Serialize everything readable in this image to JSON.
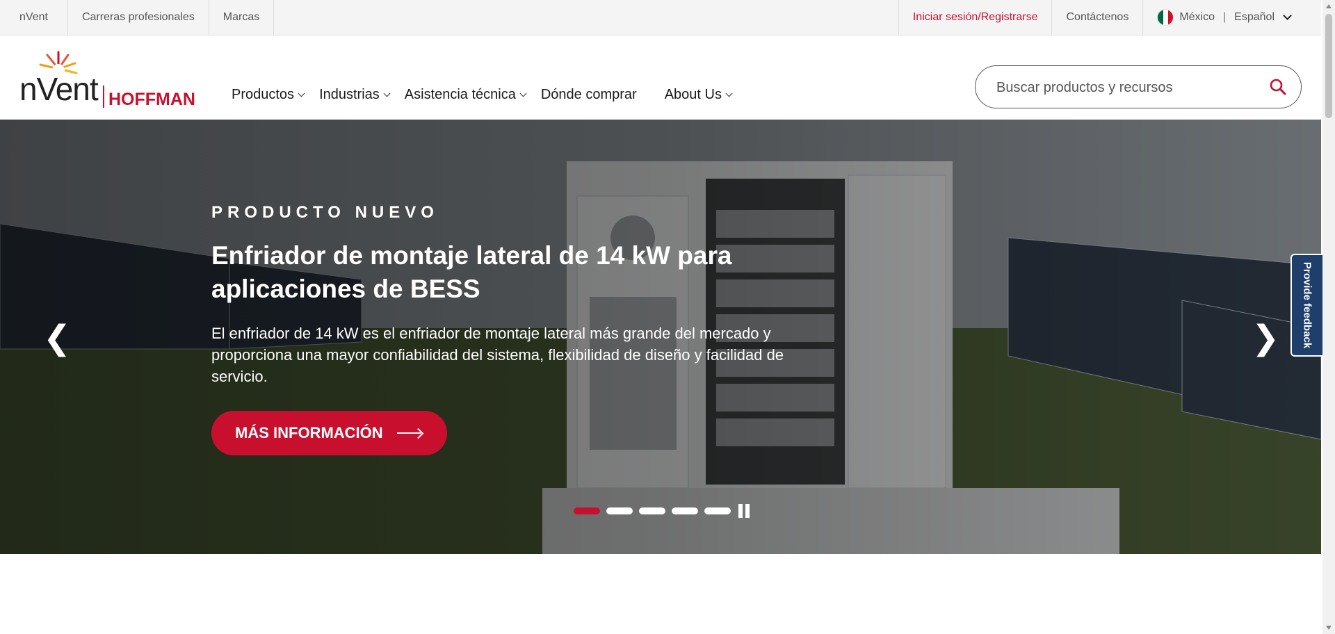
{
  "utility_bar": {
    "left_links": [
      "nVent",
      "Carreras profesionales",
      "Marcas"
    ],
    "signin": "Iniciar sesión/Registrarse",
    "contact": "Contáctenos",
    "country": "México",
    "separator": "|",
    "language": "Español"
  },
  "logo": {
    "wordmark": "nVent",
    "brand": "HOFFMAN"
  },
  "nav": {
    "items": [
      "Productos",
      "Industrias",
      "Asistencia técnica",
      "Dónde comprar",
      "About Us"
    ]
  },
  "search": {
    "placeholder": "Buscar productos y recursos"
  },
  "hero": {
    "eyebrow": "PRODUCTO NUEVO",
    "title": "Enfriador de montaje lateral de 14 kW para aplicaciones de BESS",
    "description": "El enfriador de 14 kW es el enfriador de montaje lateral más grande del mercado y proporciona una mayor confiabilidad del sistema, flexibilidad de diseño y facilidad de servicio.",
    "cta": "MÁS INFORMACIÓN",
    "prev_glyph": "❮",
    "next_glyph": "❯",
    "slide_count": 5,
    "active_slide": 1
  },
  "feedback": {
    "label": "Provide feedback"
  },
  "colors": {
    "accent": "#c8102e",
    "feedback_bg": "#1e3f6b"
  }
}
